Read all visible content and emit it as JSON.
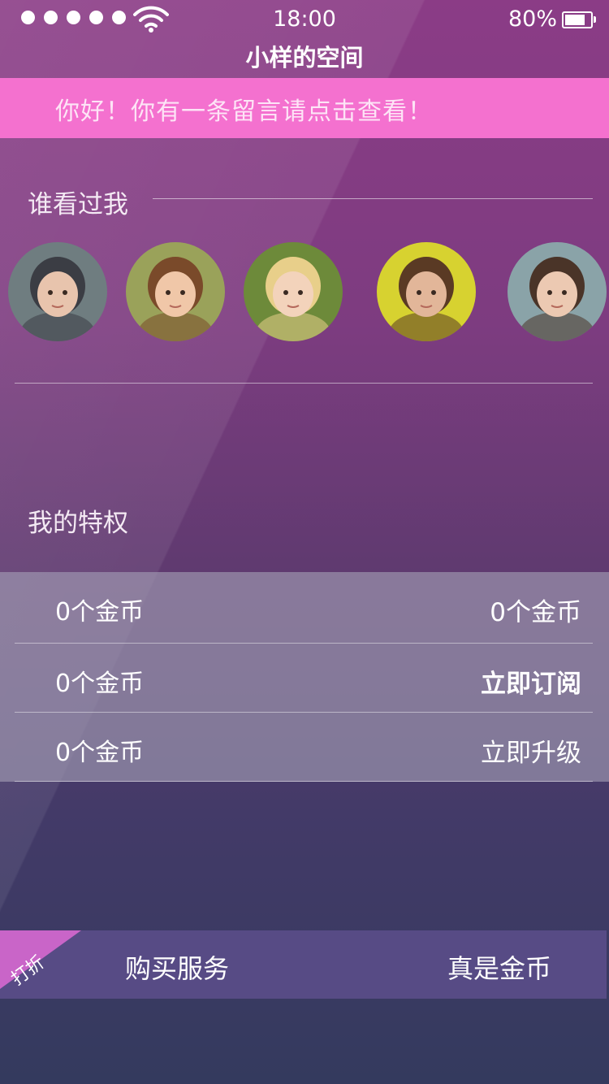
{
  "status_bar": {
    "time": "18:00",
    "battery": "80%"
  },
  "header": {
    "title": "小样的空间"
  },
  "notice": {
    "text": "你好！你有一条留言请点击查看！"
  },
  "visitors": {
    "title": "谁看过我",
    "avatars": [
      {
        "name": "avatar-boy-glasses",
        "bg": "#6f7d80",
        "skin": "#e8c4ad",
        "hair": "#3b3d44"
      },
      {
        "name": "avatar-girl-teddy",
        "bg": "#9aa25a",
        "skin": "#f0c7a8",
        "hair": "#7a4a2a"
      },
      {
        "name": "avatar-blonde-girl",
        "bg": "#6d8a3a",
        "skin": "#f3d3bb",
        "hair": "#e8cf8a"
      },
      {
        "name": "avatar-curly-girl",
        "bg": "#d7d230",
        "skin": "#e2b699",
        "hair": "#5a3a24"
      },
      {
        "name": "avatar-boy-hat",
        "bg": "#8aa3a8",
        "skin": "#ecc9b2",
        "hair": "#4a3428"
      }
    ]
  },
  "privileges": {
    "title": "我的特权",
    "rows": [
      {
        "left": "0个金币",
        "right": "0个金币"
      },
      {
        "left": "0个金币",
        "right": "立即订阅"
      },
      {
        "left": "0个金币",
        "right": "立即升级"
      }
    ]
  },
  "purchase": {
    "badge": "打折",
    "label": "购买服务",
    "coin": "真是金币"
  },
  "colors": {
    "notice_bg": "#f471cf",
    "buy_bar": "#574b85",
    "ribbon": "#c965c8"
  }
}
